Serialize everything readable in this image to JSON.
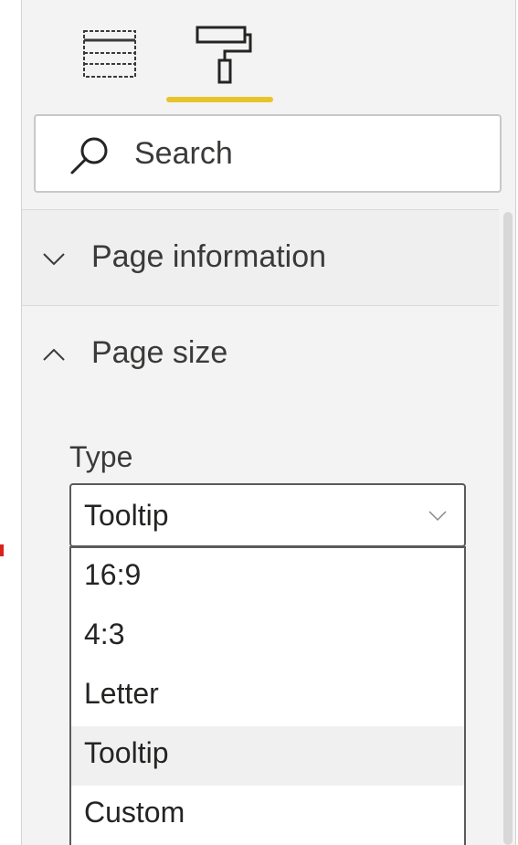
{
  "search": {
    "label": "Search",
    "icon": "search-icon"
  },
  "tabs": [
    {
      "name": "fields",
      "icon": "fields-icon",
      "active": false
    },
    {
      "name": "format",
      "icon": "paint-roller-icon",
      "active": true
    }
  ],
  "sections": [
    {
      "label": "Page information",
      "expanded": false
    },
    {
      "label": "Page size",
      "expanded": true
    }
  ],
  "page_size": {
    "type_label": "Type",
    "selected": "Tooltip",
    "options": [
      "16:9",
      "4:3",
      "Letter",
      "Tooltip",
      "Custom"
    ],
    "highlighted_index": 3
  },
  "colors": {
    "accent": "#e8c42a",
    "panel_bg": "#f3f3f3",
    "highlight": "#f0f0f0"
  }
}
